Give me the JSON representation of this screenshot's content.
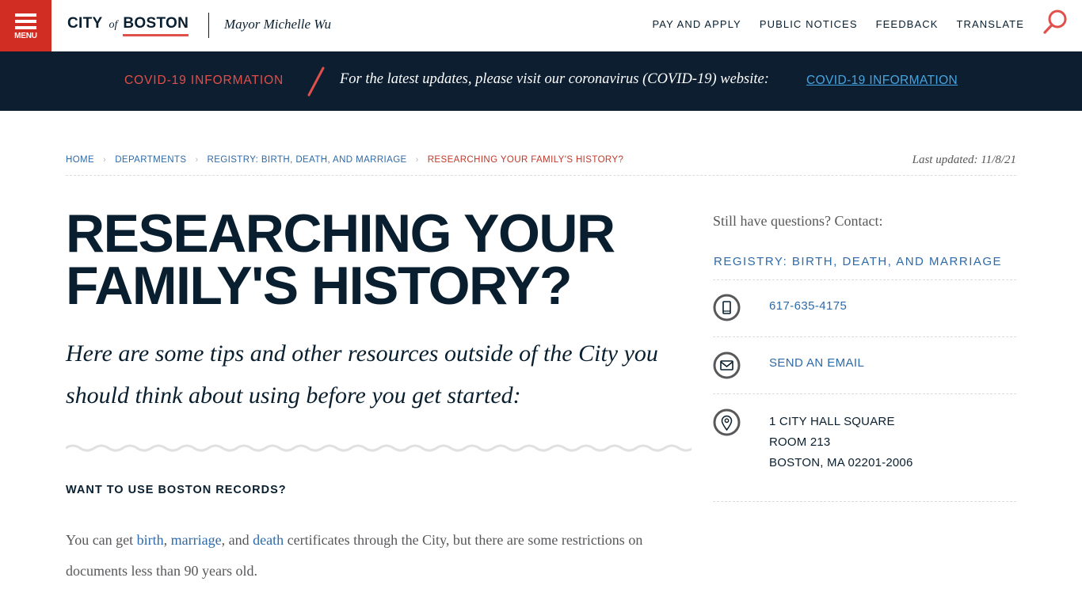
{
  "header": {
    "menu_label": "MENU",
    "logo": {
      "city": "CITY",
      "of": "of",
      "boston": "BOSTON"
    },
    "mayor": "Mayor Michelle Wu",
    "nav": [
      "PAY AND APPLY",
      "PUBLIC NOTICES",
      "FEEDBACK",
      "TRANSLATE"
    ],
    "search_icon": "search-icon"
  },
  "alert": {
    "label": "COVID-19 INFORMATION",
    "message": "For the latest updates, please visit our coronavirus (COVID-19) website:",
    "link": "COVID-19 INFORMATION"
  },
  "breadcrumb": {
    "items": [
      "HOME",
      "DEPARTMENTS",
      "REGISTRY: BIRTH, DEATH, AND MARRIAGE"
    ],
    "current": "RESEARCHING YOUR FAMILY'S HISTORY?",
    "separator": "›"
  },
  "last_updated": "Last updated: 11/8/21",
  "page": {
    "title": "RESEARCHING YOUR FAMILY'S HISTORY?",
    "intro": "Here are some tips and other resources outside of the City you should think about using before you get started:",
    "section_heading": "WANT TO USE BOSTON RECORDS?",
    "paragraph": {
      "prefix": "You can get ",
      "link_birth": "birth",
      "comma1": ", ",
      "link_marriage": "marriage",
      "mid": ", and ",
      "link_death": "death",
      "suffix": " certificates through the City, but there are some restrictions on documents less than 90 years old."
    }
  },
  "sidebar": {
    "question": "Still have questions? Contact:",
    "department": "REGISTRY: BIRTH, DEATH, AND MARRIAGE",
    "phone": "617-635-4175",
    "email_label": "SEND AN EMAIL",
    "address": [
      "1 CITY HALL SQUARE",
      "ROOM 213",
      "BOSTON, MA 02201-2006"
    ],
    "icons": [
      "phone-icon",
      "email-icon",
      "location-icon"
    ]
  },
  "colors": {
    "brand_red": "#d22d23",
    "navy": "#091f2f",
    "banner_bg": "#0c1e2f",
    "link_blue": "#2e6aa8",
    "banner_link": "#45a5e3",
    "accent_red": "#e0504a"
  }
}
